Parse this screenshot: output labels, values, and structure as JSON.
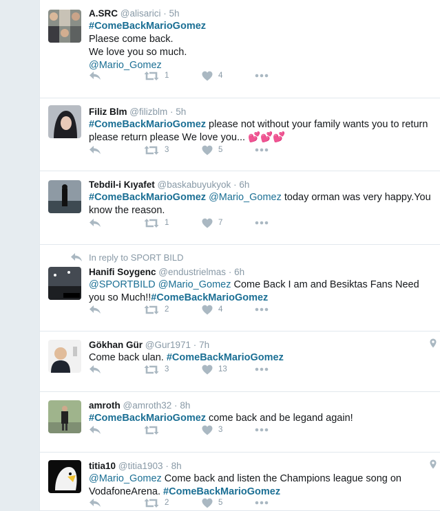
{
  "tweets": [
    {
      "fullname": "A.SRC",
      "username": "@alisarici",
      "sep": "·",
      "time": "5h",
      "lines": [
        [
          {
            "t": "#ComeBackMarioGomez",
            "k": "hashtag"
          }
        ],
        [
          {
            "t": "Plaese come back.",
            "k": "plain"
          }
        ],
        [
          {
            "t": "We love you so much.",
            "k": "plain"
          }
        ],
        [
          {
            "t": "@Mario_Gomez",
            "k": "mention"
          }
        ]
      ],
      "retweets": "1",
      "likes": "4",
      "geo": false
    },
    {
      "fullname": "Filiz Blm",
      "username": "@filizblm",
      "sep": "·",
      "time": "5h",
      "lines": [
        [
          {
            "t": "#ComeBackMarioGomez",
            "k": "hashtag"
          },
          {
            "t": " please not without your family wants you to return please return please We love you... ",
            "k": "plain"
          },
          {
            "t": "💕💕💕",
            "k": "emoji"
          }
        ]
      ],
      "retweets": "3",
      "likes": "5",
      "geo": false
    },
    {
      "fullname": "Tebdil-i Kıyafet",
      "username": "@baskabuyukyok",
      "sep": "·",
      "time": "6h",
      "lines": [
        [
          {
            "t": "#ComeBackMarioGomez",
            "k": "hashtag"
          },
          {
            "t": " ",
            "k": "plain"
          },
          {
            "t": "@Mario_Gomez",
            "k": "mention"
          },
          {
            "t": "  today orman was very happy.You know the reason.",
            "k": "plain"
          }
        ]
      ],
      "retweets": "1",
      "likes": "7",
      "geo": false
    },
    {
      "context": "In reply to SPORT BILD",
      "fullname": "Hanifi Soygenc",
      "username": "@endustrielmas",
      "sep": "·",
      "time": "6h",
      "lines": [
        [
          {
            "t": "@SPORTBILD",
            "k": "mention"
          },
          {
            "t": " ",
            "k": "plain"
          },
          {
            "t": "@Mario_Gomez",
            "k": "mention"
          },
          {
            "t": " Come Back I am and Besiktas Fans Need you so Much!!",
            "k": "plain"
          },
          {
            "t": "#ComeBackMarioGomez",
            "k": "hashtag"
          }
        ]
      ],
      "retweets": "2",
      "likes": "4",
      "geo": false
    },
    {
      "fullname": "Gökhan Gür",
      "username": "@Gur1971",
      "sep": "·",
      "time": "7h",
      "lines": [
        [
          {
            "t": "Come back ulan.  ",
            "k": "plain"
          },
          {
            "t": "#ComeBackMarioGomez",
            "k": "hashtag"
          }
        ]
      ],
      "retweets": "3",
      "likes": "13",
      "geo": true
    },
    {
      "fullname": "amroth",
      "username": "@amroth32",
      "sep": "·",
      "time": "8h",
      "lines": [
        [
          {
            "t": "#ComeBackMarioGomez",
            "k": "hashtag"
          },
          {
            "t": " come back and be legand again!",
            "k": "plain"
          }
        ]
      ],
      "retweets": "",
      "likes": "3",
      "geo": false
    },
    {
      "fullname": "titia10",
      "username": "@titia1903",
      "sep": "·",
      "time": "8h",
      "lines": [
        [
          {
            "t": "@Mario_Gomez",
            "k": "mention"
          },
          {
            "t": " Come back and listen the Champions league song on VodafoneArena. ",
            "k": "plain"
          },
          {
            "t": "#ComeBackMarioGomez",
            "k": "hashtag"
          }
        ]
      ],
      "retweets": "2",
      "likes": "5",
      "geo": true
    }
  ],
  "colors": {
    "link": "#1b6f94",
    "meta": "#8899a6",
    "border": "#e1e8ed",
    "background": "#e6ecf0"
  },
  "icons": {
    "reply": "reply-icon",
    "retweet": "retweet-icon",
    "like": "heart-icon",
    "more": "more-icon",
    "geo": "location-pin-icon"
  }
}
